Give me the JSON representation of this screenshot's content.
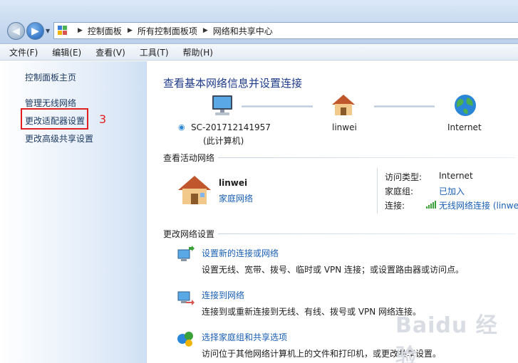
{
  "address": {
    "breadcrumbs": [
      "控制面板",
      "所有控制面板项",
      "网络和共享中心"
    ]
  },
  "menu": [
    "文件(F)",
    "编辑(E)",
    "查看(V)",
    "工具(T)",
    "帮助(H)"
  ],
  "sidebar": {
    "home": "控制面板主页",
    "items": [
      "管理无线网络",
      "更改适配器设置",
      "更改高级共享设置"
    ],
    "annotation_number": "3"
  },
  "main": {
    "title": "查看基本网络信息并设置连接",
    "network_map": {
      "computer_name": "SC-201712141957",
      "computer_sub": "(此计算机)",
      "network_name": "linwei",
      "internet_label": "Internet"
    },
    "active_networks": {
      "heading": "查看活动网络",
      "network_name": "linwei",
      "network_type": "家庭网络",
      "access_type_label": "访问类型:",
      "access_type_value": "Internet",
      "homegroup_label": "家庭组:",
      "homegroup_value": "已加入",
      "connection_label": "连接:",
      "connection_value": "无线网络连接 (linwei"
    },
    "change_settings": {
      "heading": "更改网络设置",
      "tasks": [
        {
          "title": "设置新的连接或网络",
          "desc": "设置无线、宽带、拨号、临时或 VPN 连接；或设置路由器或访问点。"
        },
        {
          "title": "连接到网络",
          "desc": "连接到或重新连接到无线、有线、拨号或 VPN 网络连接。"
        },
        {
          "title": "选择家庭组和共享选项",
          "desc": "访问位于其他网络计算机上的文件和打印机，或更改共享设置。"
        }
      ]
    }
  },
  "watermark": "Baidu 经验",
  "colors": {
    "link": "#1a5fb4",
    "title": "#1e3b8a",
    "highlight": "#e02020"
  }
}
